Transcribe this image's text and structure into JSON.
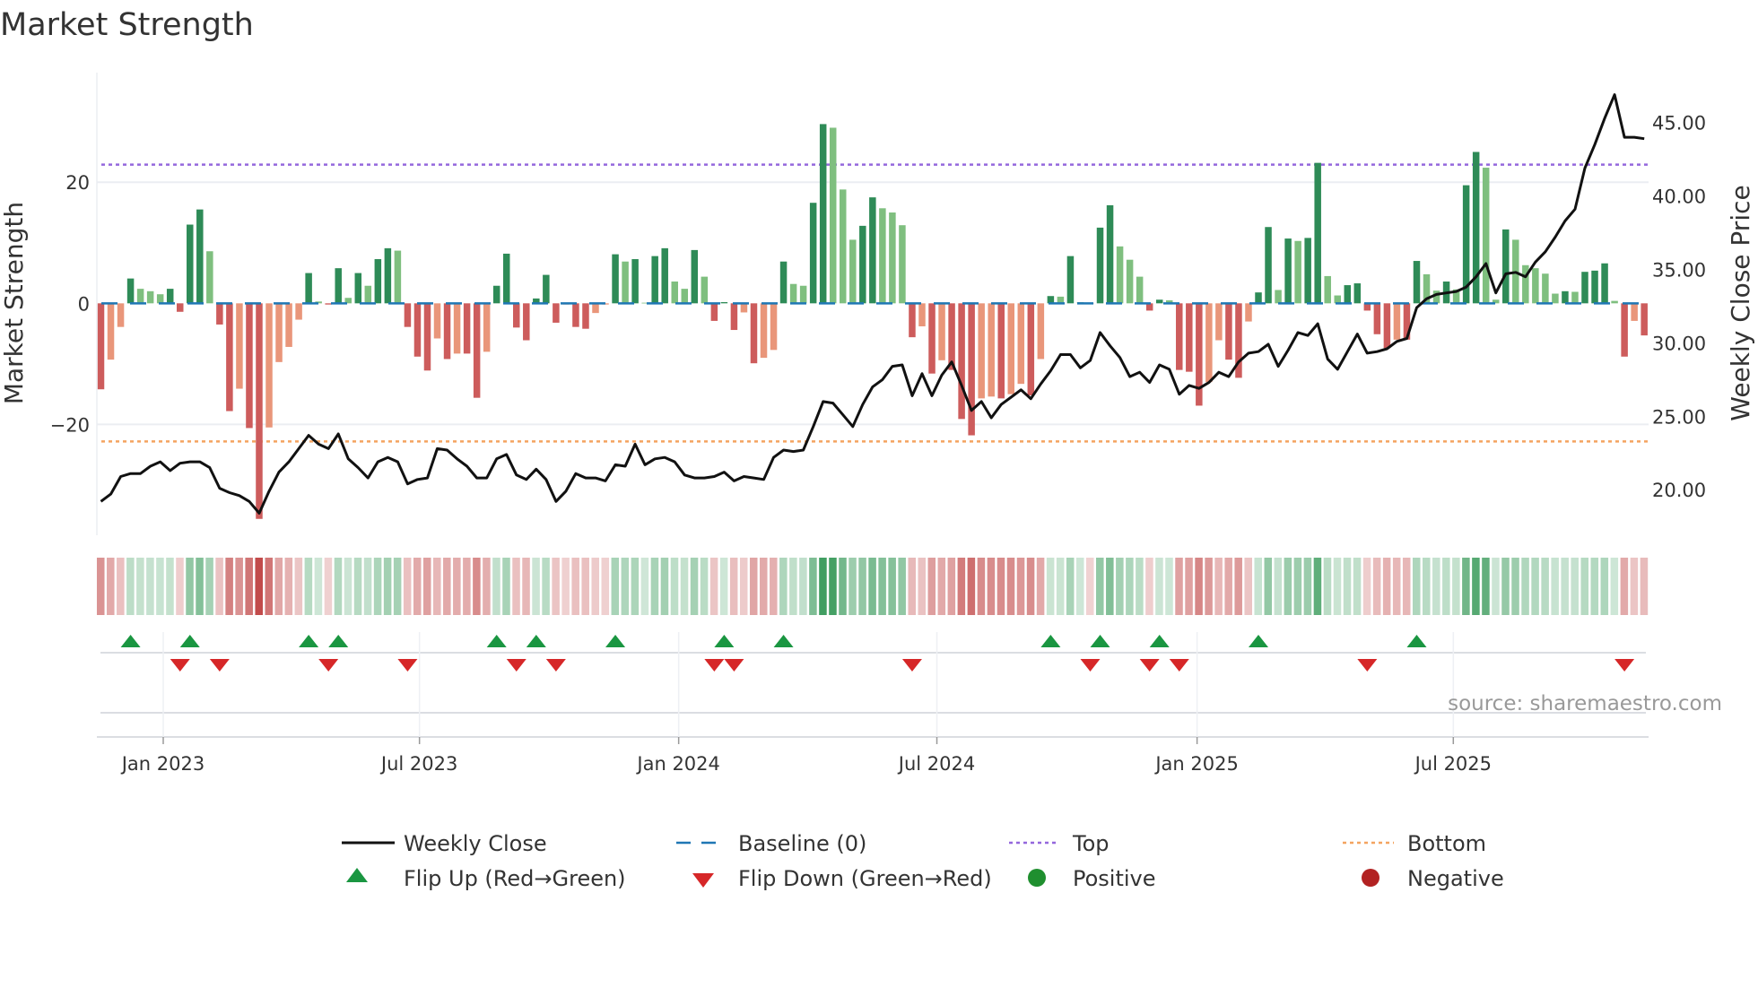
{
  "title": "Market Strength",
  "source": "source: sharemaestro.com",
  "legend": {
    "weekly_close": "Weekly Close",
    "baseline": "Baseline (0)",
    "top": "Top",
    "bottom": "Bottom",
    "flip_up": "Flip Up (Red→Green)",
    "flip_down": "Flip Down (Green→Red)",
    "positive": "Positive",
    "negative": "Negative"
  },
  "colors": {
    "strong_positive": "#2e8b57",
    "weak_positive": "#7fbf7f",
    "strong_negative": "#cd5c5c",
    "weak_negative": "#e9967a",
    "price_line": "#111111",
    "baseline": "#1f77b4",
    "top": "#9467dd",
    "bottom": "#f4a460",
    "flip_up": "#1a9641",
    "flip_down": "#d62728",
    "positive_dot": "#1f8f2f",
    "negative_dot": "#b22222"
  },
  "chart_data": {
    "type": "bar",
    "title": "Market Strength",
    "ylabel": "Market Strength",
    "y2label": "Weekly Close Price",
    "ylim": [
      -38.3,
      38.1
    ],
    "y2lim": [
      16.9,
      48.4
    ],
    "y_ticks": [
      {
        "value": 20,
        "label": "20"
      },
      {
        "value": 0,
        "label": "0"
      },
      {
        "value": -20,
        "label": "−20"
      }
    ],
    "y2_ticks": [
      {
        "value": 45,
        "label": "45.00"
      },
      {
        "value": 40,
        "label": "40.00"
      },
      {
        "value": 35,
        "label": "35.00"
      },
      {
        "value": 30,
        "label": "30.00"
      },
      {
        "value": 25,
        "label": "25.00"
      },
      {
        "value": 20,
        "label": "20.00"
      }
    ],
    "x_ticks": [
      {
        "week": 7.3,
        "label": "Jan 2023"
      },
      {
        "week": 33.2,
        "label": "Jul 2023"
      },
      {
        "week": 59.4,
        "label": "Jan 2024"
      },
      {
        "week": 85.5,
        "label": "Jul 2024"
      },
      {
        "week": 111.8,
        "label": "Jan 2025"
      },
      {
        "week": 137.7,
        "label": "Jul 2025"
      }
    ],
    "top_level": 22.9,
    "bottom_level": -22.8,
    "baseline": 0,
    "strength": [
      -14.2,
      -9.3,
      -3.9,
      4.1,
      2.4,
      2.0,
      1.5,
      2.4,
      -1.4,
      13.0,
      15.5,
      8.6,
      -3.5,
      -17.8,
      -14.1,
      -20.6,
      -35.6,
      -20.5,
      -9.7,
      -7.2,
      -2.7,
      5.0,
      0.3,
      -0.2,
      5.8,
      0.9,
      5.0,
      2.9,
      7.3,
      9.1,
      8.7,
      -3.9,
      -8.8,
      -11.1,
      -5.8,
      -9.2,
      -8.3,
      -8.3,
      -15.6,
      -8.0,
      2.9,
      8.2,
      -4.0,
      -6.1,
      0.8,
      4.7,
      -3.2,
      -0.2,
      -3.9,
      -4.2,
      -1.6,
      -0.2,
      8.1,
      6.9,
      7.3,
      0.1,
      7.8,
      9.1,
      3.6,
      2.4,
      8.8,
      4.4,
      -2.9,
      0.2,
      -4.4,
      -1.5,
      -9.9,
      -9.0,
      -7.7,
      6.9,
      3.2,
      2.9,
      16.6,
      29.6,
      29.0,
      18.8,
      10.5,
      12.8,
      17.5,
      15.7,
      15.0,
      12.9,
      -5.6,
      -3.8,
      -11.6,
      -9.4,
      -11.0,
      -19.1,
      -21.8,
      -15.7,
      -15.4,
      -15.7,
      -15.0,
      -13.3,
      -15.2,
      -9.2,
      1.2,
      1.1,
      7.8,
      0.2,
      -0.1,
      12.5,
      16.2,
      9.4,
      7.2,
      4.4,
      -1.2,
      0.6,
      0.5,
      -11.0,
      -11.3,
      -16.9,
      -13.0,
      -6.1,
      -9.3,
      -12.3,
      -3.0,
      1.8,
      12.6,
      2.2,
      10.7,
      10.3,
      10.8,
      23.2,
      4.5,
      1.3,
      3.0,
      3.3,
      -1.2,
      -5.1,
      -7.4,
      -6.0,
      -6.0,
      7.0,
      4.8,
      2.1,
      3.6,
      2.3,
      19.5,
      25.0,
      22.4,
      0.6,
      12.2,
      10.5,
      6.3,
      5.8,
      4.9,
      1.6,
      2.0,
      1.9,
      5.2,
      5.4,
      6.6,
      0.4,
      -8.8,
      -2.9,
      -5.3
    ],
    "weekly_close": [
      19.2,
      19.7,
      20.9,
      21.1,
      21.1,
      21.6,
      21.9,
      21.3,
      21.8,
      21.9,
      21.9,
      21.5,
      20.1,
      19.8,
      19.6,
      19.2,
      18.4,
      19.9,
      21.2,
      21.9,
      22.8,
      23.7,
      23.1,
      22.8,
      23.8,
      22.1,
      21.5,
      20.8,
      21.9,
      22.2,
      21.9,
      20.4,
      20.7,
      20.8,
      22.8,
      22.7,
      22.1,
      21.6,
      20.8,
      20.8,
      22.1,
      22.4,
      21.0,
      20.7,
      21.4,
      20.7,
      19.2,
      19.9,
      21.1,
      20.8,
      20.8,
      20.6,
      21.7,
      21.6,
      23.1,
      21.7,
      22.1,
      22.2,
      21.9,
      21.0,
      20.8,
      20.8,
      20.9,
      21.2,
      20.6,
      20.9,
      20.8,
      20.7,
      22.2,
      22.7,
      22.6,
      22.7,
      24.3,
      26.0,
      25.9,
      25.1,
      24.3,
      25.8,
      27.0,
      27.5,
      28.4,
      28.5,
      26.4,
      27.9,
      26.4,
      27.8,
      28.7,
      27.1,
      25.4,
      26.0,
      24.9,
      25.8,
      26.3,
      26.8,
      26.2,
      27.2,
      28.1,
      29.2,
      29.2,
      28.3,
      28.8,
      30.7,
      29.8,
      29.0,
      27.7,
      28.0,
      27.3,
      28.5,
      28.2,
      26.5,
      27.1,
      26.9,
      27.3,
      28.0,
      27.7,
      28.7,
      29.3,
      29.4,
      29.9,
      28.4,
      29.5,
      30.7,
      30.5,
      31.3,
      28.9,
      28.2,
      29.4,
      30.6,
      29.3,
      29.4,
      29.6,
      30.1,
      30.3,
      32.4,
      33.0,
      33.3,
      33.4,
      33.5,
      33.8,
      34.5,
      35.4,
      33.4,
      34.7,
      34.8,
      34.5,
      35.5,
      36.2,
      37.2,
      38.3,
      39.1,
      41.9,
      43.5,
      45.3,
      46.9,
      44.0,
      44.0,
      43.9
    ],
    "grid": true,
    "legend_position": "bottom"
  }
}
